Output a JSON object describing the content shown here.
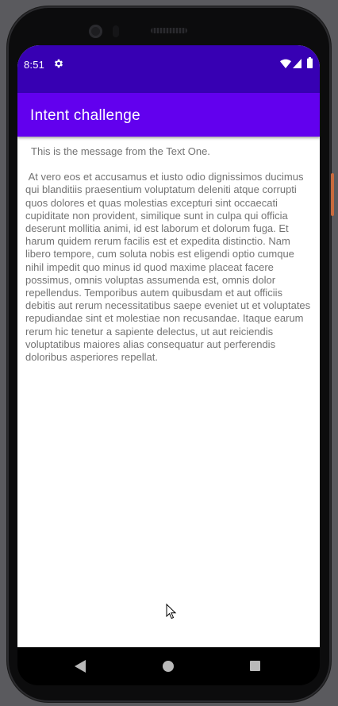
{
  "status_bar": {
    "time": "8:51",
    "icons": [
      "settings-gear-icon",
      "wifi-icon",
      "cell-signal-icon",
      "battery-icon"
    ]
  },
  "app_bar": {
    "title": "Intent challenge"
  },
  "content": {
    "message": "This is the message from the Text One.",
    "body": " At vero eos et accusamus et iusto odio dignissimos ducimus qui blanditiis praesentium voluptatum deleniti atque corrupti quos dolores et quas molestias excepturi sint occaecati cupiditate non provident, similique sunt in culpa qui officia deserunt mollitia animi, id est laborum et dolorum fuga. Et harum quidem rerum facilis est et expedita distinctio. Nam libero tempore, cum soluta nobis est eligendi optio cumque nihil impedit quo minus id quod maxime placeat facere possimus, omnis voluptas assumenda est, omnis dolor repellendus. Temporibus autem quibusdam et aut officiis debitis aut rerum necessitatibus saepe eveniet ut et voluptates repudiandae sint et molestiae non recusandae. Itaque earum rerum hic tenetur a sapiente delectus, ut aut reiciendis voluptatibus maiores alias consequatur aut perferendis doloribus asperiores repellat."
  },
  "nav_bar": {
    "buttons": [
      "back-icon",
      "home-icon",
      "recents-icon"
    ]
  },
  "colors": {
    "status_bar": "#3700b3",
    "app_bar": "#6200ee",
    "text": "#737373",
    "background": "#ffffff"
  }
}
